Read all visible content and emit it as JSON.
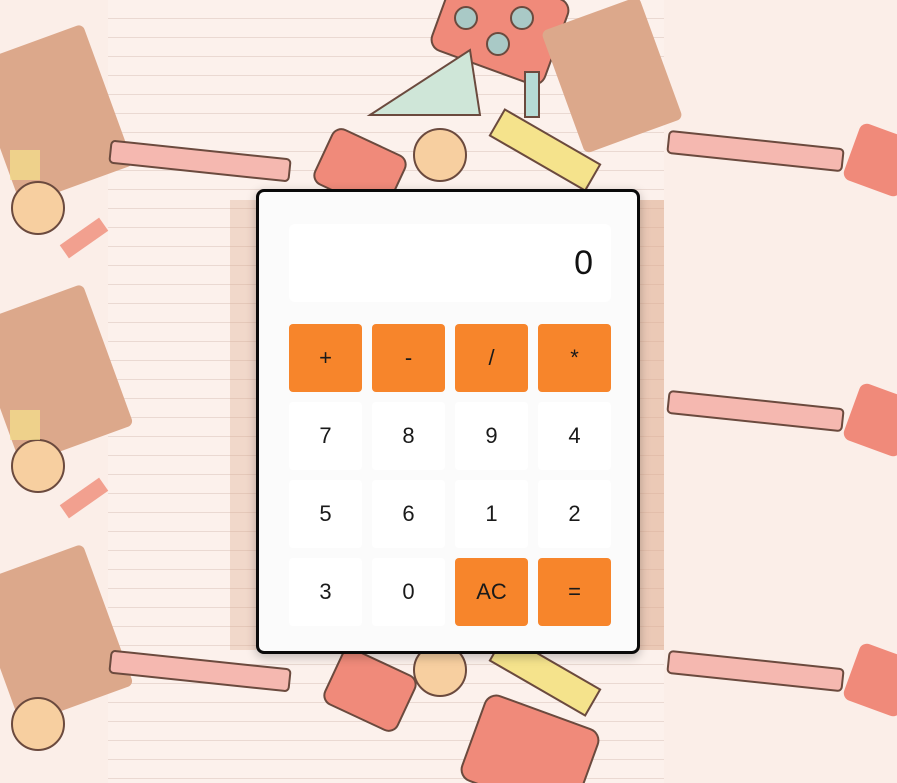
{
  "colors": {
    "accent": "#f7852b",
    "page_background": "#fcf1ec",
    "key_background": "#ffffff",
    "border": "#0a0a0a"
  },
  "display": {
    "value": "0"
  },
  "keys": [
    {
      "label": "+",
      "name": "plus-key",
      "accent": true
    },
    {
      "label": "-",
      "name": "minus-key",
      "accent": true
    },
    {
      "label": "/",
      "name": "divide-key",
      "accent": true
    },
    {
      "label": "*",
      "name": "multiply-key",
      "accent": true
    },
    {
      "label": "7",
      "name": "digit-7-key",
      "accent": false
    },
    {
      "label": "8",
      "name": "digit-8-key",
      "accent": false
    },
    {
      "label": "9",
      "name": "digit-9-key",
      "accent": false
    },
    {
      "label": "4",
      "name": "digit-4-key",
      "accent": false
    },
    {
      "label": "5",
      "name": "digit-5-key",
      "accent": false
    },
    {
      "label": "6",
      "name": "digit-6-key",
      "accent": false
    },
    {
      "label": "1",
      "name": "digit-1-key",
      "accent": false
    },
    {
      "label": "2",
      "name": "digit-2-key",
      "accent": false
    },
    {
      "label": "3",
      "name": "digit-3-key",
      "accent": false
    },
    {
      "label": "0",
      "name": "digit-0-key",
      "accent": false
    },
    {
      "label": "AC",
      "name": "all-clear-key",
      "accent": true
    },
    {
      "label": "=",
      "name": "equals-key",
      "accent": true
    }
  ]
}
